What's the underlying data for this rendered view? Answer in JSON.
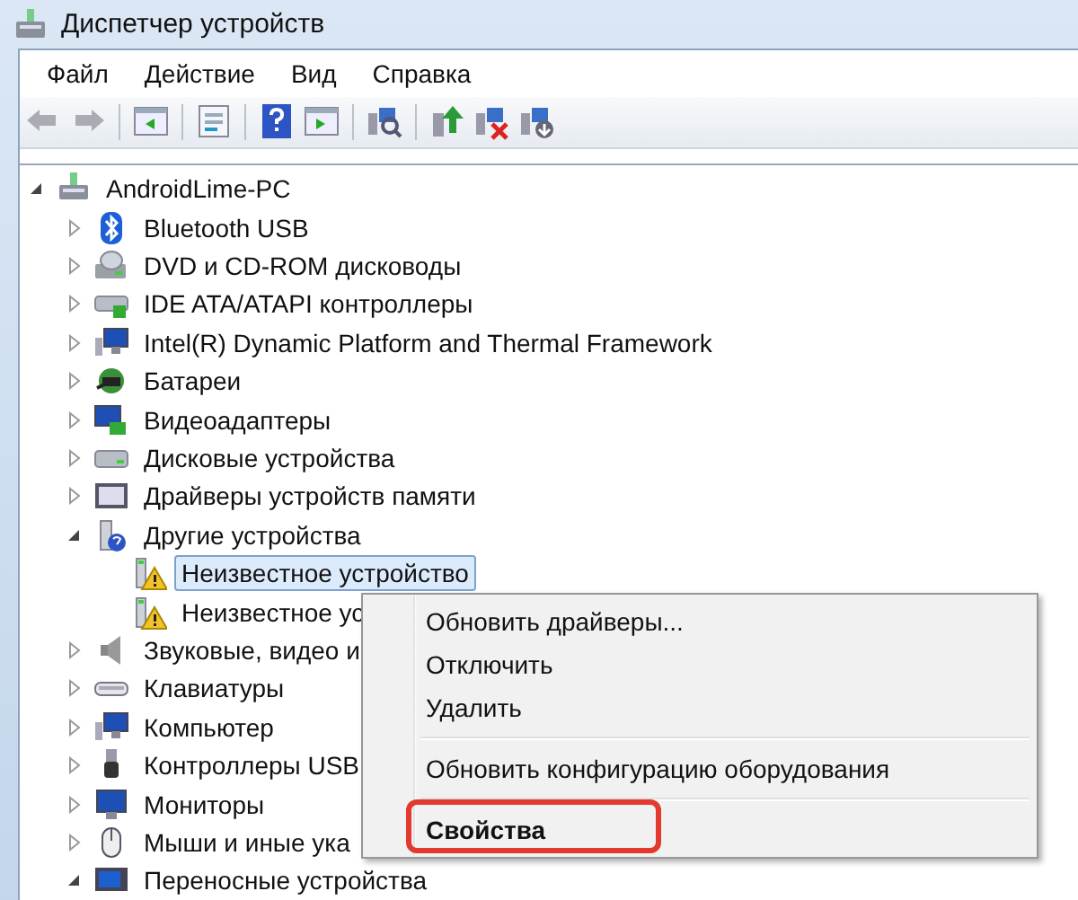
{
  "window": {
    "title": "Диспетчер устройств"
  },
  "menu": [
    "Файл",
    "Действие",
    "Вид",
    "Справка"
  ],
  "tree": {
    "label": "AndroidLime-PC",
    "expanded": true,
    "children": [
      {
        "label": "Bluetooth USB",
        "expanded": false
      },
      {
        "label": "DVD и CD-ROM дисководы",
        "expanded": false
      },
      {
        "label": "IDE ATA/ATAPI контроллеры",
        "expanded": false
      },
      {
        "label": "Intel(R) Dynamic Platform and Thermal Framework",
        "expanded": false
      },
      {
        "label": "Батареи",
        "expanded": false
      },
      {
        "label": "Видеоадаптеры",
        "expanded": false
      },
      {
        "label": "Дисковые устройства",
        "expanded": false
      },
      {
        "label": "Драйверы устройств памяти",
        "expanded": false
      },
      {
        "label": "Другие устройства",
        "expanded": true,
        "children": [
          {
            "label": "Неизвестное устройство",
            "selected": true
          },
          {
            "label": "Неизвестное ус",
            "selected": false
          }
        ]
      },
      {
        "label": "Звуковые, видео и",
        "expanded": false
      },
      {
        "label": "Клавиатуры",
        "expanded": false
      },
      {
        "label": "Компьютер",
        "expanded": false
      },
      {
        "label": "Контроллеры USB",
        "expanded": false
      },
      {
        "label": "Мониторы",
        "expanded": false
      },
      {
        "label": "Мыши и иные ука",
        "expanded": false
      },
      {
        "label": "Переносные устройства",
        "expanded": true
      }
    ]
  },
  "context_menu": [
    {
      "kind": "item",
      "label": "Обновить драйверы...",
      "default": false,
      "highlighted": false
    },
    {
      "kind": "item",
      "label": "Отключить",
      "default": false,
      "highlighted": false
    },
    {
      "kind": "item",
      "label": "Удалить",
      "default": false,
      "highlighted": false
    },
    {
      "kind": "separator"
    },
    {
      "kind": "item",
      "label": "Обновить конфигурацию оборудования",
      "default": false,
      "highlighted": false
    },
    {
      "kind": "separator"
    },
    {
      "kind": "item",
      "label": "Свойства",
      "default": true,
      "highlighted": true
    }
  ]
}
